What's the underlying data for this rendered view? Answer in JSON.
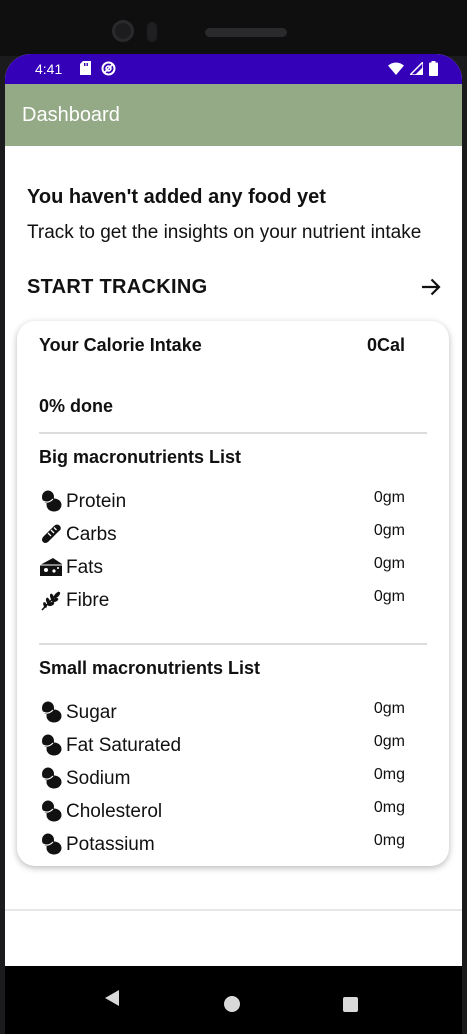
{
  "status_bar": {
    "time": "4:41",
    "left_icons": [
      "sd-card-icon",
      "no-disturb-icon"
    ],
    "right_icons": [
      "wifi-icon",
      "signal-icon",
      "battery-icon"
    ],
    "color": "#3400b8"
  },
  "app_bar": {
    "title": "Dashboard",
    "color": "#94a986"
  },
  "empty_state": {
    "title": "You haven't added any food yet",
    "subtitle": "Track to get the insights on your nutrient intake"
  },
  "start_tracking": {
    "label": "START TRACKING",
    "icon": "arrow-right-icon"
  },
  "calorie_card": {
    "label": "Your Calorie Intake",
    "value": "0Cal",
    "progress_text": "0% done",
    "progress_percent": 0
  },
  "big_macros": {
    "title": "Big macronutrients List",
    "items": [
      {
        "label": "Protein",
        "value": "0gm",
        "icon": "protein-beans-icon"
      },
      {
        "label": "Carbs",
        "value": "0gm",
        "icon": "bread-icon"
      },
      {
        "label": "Fats",
        "value": "0gm",
        "icon": "cheese-icon"
      },
      {
        "label": "Fibre",
        "value": "0gm",
        "icon": "wheat-icon"
      }
    ]
  },
  "small_macros": {
    "title": "Small macronutrients List",
    "items": [
      {
        "label": "Sugar",
        "value": "0gm",
        "icon": "beans-icon"
      },
      {
        "label": "Fat Saturated",
        "value": "0gm",
        "icon": "beans-icon"
      },
      {
        "label": "Sodium",
        "value": "0mg",
        "icon": "beans-icon"
      },
      {
        "label": "Cholesterol",
        "value": "0mg",
        "icon": "beans-icon"
      },
      {
        "label": "Potassium",
        "value": "0mg",
        "icon": "beans-icon"
      }
    ]
  },
  "nav_bar": {
    "buttons": [
      "back-icon",
      "home-icon",
      "recents-icon"
    ]
  }
}
